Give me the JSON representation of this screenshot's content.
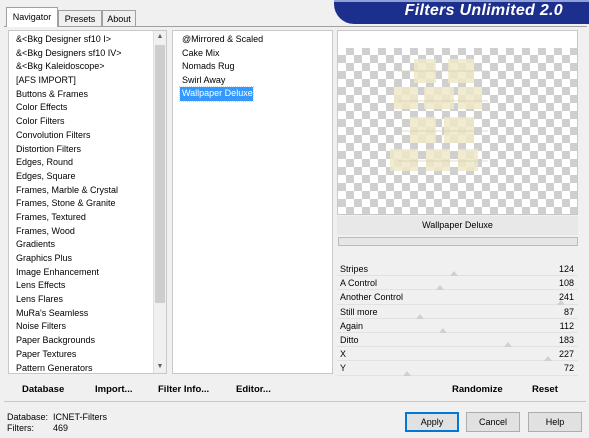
{
  "tabs": [
    "Navigator",
    "Presets",
    "About"
  ],
  "banner_title": "Filters Unlimited 2.0",
  "categories": [
    "&<Bkg Designer sf10 I>",
    "&<Bkg Designers sf10 IV>",
    "&<Bkg Kaleidoscope>",
    "[AFS IMPORT]",
    "Buttons & Frames",
    "Color Effects",
    "Color Filters",
    "Convolution Filters",
    "Distortion Filters",
    "Edges, Round",
    "Edges, Square",
    "Frames, Marble & Crystal",
    "Frames, Stone & Granite",
    "Frames, Textured",
    "Frames, Wood",
    "Gradients",
    "Graphics Plus",
    "Image Enhancement",
    "Lens Effects",
    "Lens Flares",
    "MuRa's Seamless",
    "Noise Filters",
    "Paper Backgrounds",
    "Paper Textures",
    "Pattern Generators"
  ],
  "filters": [
    "@Mirrored & Scaled",
    "Cake Mix",
    "Nomads Rug",
    "Swirl Away",
    "Wallpaper Deluxe"
  ],
  "selected_filter": "Wallpaper Deluxe",
  "filter_name_display": "Wallpaper Deluxe",
  "sliders": [
    {
      "label": "Stripes",
      "value": 124
    },
    {
      "label": "A Control",
      "value": 108
    },
    {
      "label": "Another Control",
      "value": 241
    },
    {
      "label": "Still more",
      "value": 87
    },
    {
      "label": "Again",
      "value": 112
    },
    {
      "label": "Ditto",
      "value": 183
    },
    {
      "label": "X",
      "value": 227
    },
    {
      "label": "Y",
      "value": 72
    }
  ],
  "toolbar": {
    "database": "Database",
    "import": "Import...",
    "filter_info": "Filter Info...",
    "editor": "Editor...",
    "randomize": "Randomize",
    "reset": "Reset"
  },
  "status": {
    "database_label": "Database:",
    "database_value": "ICNET-Filters",
    "filters_label": "Filters:",
    "filters_value": "469"
  },
  "buttons": {
    "apply": "Apply",
    "cancel": "Cancel",
    "help": "Help"
  },
  "colors": {
    "banner": "#1d2f8c",
    "selection": "#3399ff",
    "default_button_border": "#0078d7"
  }
}
